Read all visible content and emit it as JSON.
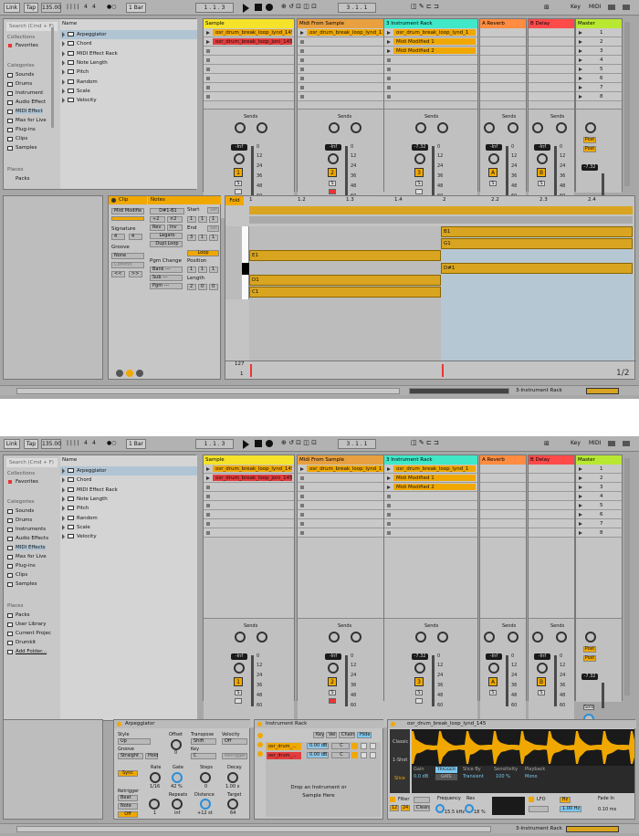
{
  "transport": {
    "link": "Link",
    "tap": "Tap",
    "tempo": "135.00",
    "sig_num": "4",
    "sig_den": "4",
    "quant": "1 Bar",
    "pos_left": "1 .  1 .  3",
    "pos_right": "3 .  1 .  1",
    "key": "Key",
    "midi": "MIDI"
  },
  "browser": {
    "search_placeholder": "Search (Cmd + F)",
    "collections_head": "Collections",
    "favorites": "Favorites",
    "categories_head": "Categories",
    "categories": [
      "Sounds",
      "Drums",
      "Instruments",
      "Audio Effects",
      "MIDI Effects",
      "Max for Live",
      "Plug-ins",
      "Clips",
      "Samples"
    ],
    "categories_s1": [
      "Sounds",
      "Drums",
      "Instrument",
      "Audio Effect",
      "MIDI Effect",
      "Max for Live",
      "Plug-ins",
      "Clips",
      "Samples"
    ],
    "places_head": "Places",
    "places": [
      "Packs",
      "User Library",
      "Current Projec",
      "Drumkit",
      "Add Folder..."
    ],
    "places_s1": [
      "Packs"
    ],
    "name_head": "Name",
    "names": [
      "Arpeggiator",
      "Chord",
      "MIDI Effect Rack",
      "Note Length",
      "Pitch",
      "Random",
      "Scale",
      "Velocity"
    ]
  },
  "tracks": [
    {
      "name": "Sample",
      "color": "#f5e32a",
      "num": "1",
      "clips": [
        "osr_drum_break_loop_lynd_145",
        "osr_drum_break_loop_joni_145"
      ],
      "clip_colors": [
        "#f0a800",
        "#e33c3c"
      ]
    },
    {
      "name": "Midi From Sample",
      "color": "#e8a040",
      "num": "2",
      "clips": [
        "osr_drum_break_loop_lynd_1",
        ""
      ],
      "clip_colors": [
        "#f0a800",
        ""
      ]
    },
    {
      "name": "3 Instrument Rack",
      "color": "#40e8c8",
      "num": "3",
      "clips": [
        "osr_drum_break_loop_lynd_1",
        "Midi Modified 1",
        "Midi Modified 2"
      ],
      "clip_colors": [
        "#f0a800",
        "#f0a800",
        "#f0a800"
      ]
    }
  ],
  "returns": [
    {
      "name": "A Reverb",
      "color": "#ff8c40",
      "letter": "A"
    },
    {
      "name": "B Delay",
      "color": "#ff4a4a",
      "letter": "B"
    }
  ],
  "master": {
    "name": "Master",
    "color": "#b8e832",
    "scenes": [
      "1",
      "2",
      "3",
      "4",
      "5",
      "6",
      "7",
      "8"
    ]
  },
  "mixer": {
    "sends": "Sends",
    "vol_inf": "-Inf",
    "vol_master": "-7.32",
    "vol_t3": "-7.32",
    "db": [
      "12",
      "24",
      "36",
      "48",
      "60"
    ],
    "zero": "0",
    "s": "S",
    "post": "Post",
    "solo": "Solo"
  },
  "clip_view": {
    "clip": "Clip",
    "notes": "Notes",
    "clip_name": "Midi Modifie",
    "range": "D#1-B1",
    "div": "÷2",
    "mul": "×2",
    "rev": "Rev",
    "inv": "Inv",
    "legato": "Legato",
    "dupl": "Dupl.Loop",
    "start": "Start",
    "end": "End",
    "set": "Set",
    "loop": "Loop",
    "position": "Position",
    "length": "Length",
    "signature": "Signature",
    "groove": "Groove",
    "none": "None",
    "commit": "Commit",
    "pgm_change": "Pgm Change",
    "bank": "Bank ---",
    "sub": "Sub ---",
    "pgm": "Pgm ---",
    "start_vals": [
      "1",
      "1",
      "1"
    ],
    "end_vals": [
      "3",
      "1",
      "1"
    ],
    "pos_vals": [
      "1",
      "1",
      "1"
    ],
    "len_vals": [
      "2",
      "0",
      "0"
    ],
    "sig_vals": [
      "4",
      "4"
    ],
    "fold": "Fold",
    "ruler": [
      "1",
      "1.2",
      "1.3",
      "1.4",
      "2",
      "2.2",
      "2.3",
      "2.4"
    ],
    "keys": [
      "B1",
      "G1",
      "E1",
      "D#1",
      "D1",
      "C1"
    ],
    "velocity_max": "127",
    "velocity_min": "1",
    "page": "1/2"
  },
  "device_chain": {
    "arp": {
      "title": "Arpeggiator",
      "style": "Style",
      "style_val": "Up",
      "groove": "Groove",
      "groove_val": "Straight",
      "hold": "Hold",
      "offset": "Offset",
      "transpose": "Transpose",
      "transpose_val": "Shift",
      "key": "Key",
      "key_val": "C",
      "velocity": "Velocity",
      "vel_off": "Off",
      "retrigger_btn": "Retrigger",
      "rate": "Rate",
      "rate_val": "1/16",
      "gate": "Gate",
      "gate_val": "42 %",
      "steps": "Steps",
      "steps_val": "0",
      "decay": "Decay",
      "decay_val": "1.00 s",
      "sync": "Sync",
      "retrigger": "Retrigger",
      "beat": "Beat",
      "note": "Note",
      "off": "Off",
      "repeats": "Repeats",
      "repeats_val": "inf",
      "distance": "Distance",
      "distance_val": "+12 st",
      "target": "Target",
      "target_val": "64",
      "offset_val": "0",
      "knob_val": "1"
    },
    "rack": {
      "title": "Instrument Rack",
      "key": "Key",
      "vel": "Vel",
      "chain": "Chain",
      "hide": "Hide",
      "chains": [
        "osr_drum_...",
        "osr_drum_..."
      ],
      "chain_db": "0.00 dB",
      "chain_c": "C",
      "drop": "Drop an Instrument or Sample Here"
    },
    "simpler": {
      "title": "osr_drum_break_loop_lynd_145",
      "classic": "Classic",
      "one_shot": "1-Shot",
      "slice": "Slice",
      "gain": "Gain",
      "gain_val": "0.0 dB",
      "trigger": "TRIGGER",
      "gate": "GATE",
      "slice_by": "Slice By",
      "slice_by_val": "Transient",
      "sensitivity": "Sensitivity",
      "sensitivity_val": "100 %",
      "playback": "Playback",
      "playback_val": "Mono",
      "filter": "Filter",
      "frequency": "Frequency",
      "freq_val": "15.5 kHz",
      "res": "Res",
      "res_val": "18 %",
      "lfo": "LFO",
      "hz": "Hz",
      "hz_val": "1.00 Hz",
      "fade_in": "Fade In",
      "fade_val": "0.10 ms",
      "clean": "Clean",
      "f12": "12",
      "f24": "24",
      "time_labels": [
        "0:00",
        "0:00:500",
        "0:01",
        "0:01:500"
      ]
    }
  },
  "status": {
    "device": "3-Instrument Rack"
  }
}
